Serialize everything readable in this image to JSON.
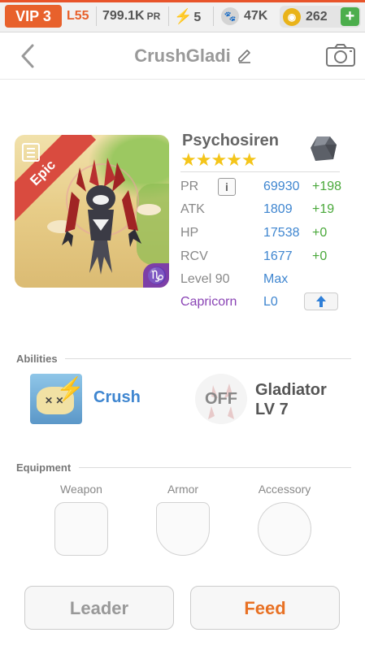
{
  "topbar": {
    "vip": "VIP 3",
    "level": "L55",
    "pr": "799.1K",
    "pr_unit": "PR",
    "energy": "5",
    "paws": "47K",
    "coins": "262",
    "plus": "+"
  },
  "header": {
    "title": "CrushGladi"
  },
  "monster": {
    "name": "Psychosiren",
    "rarity": "Epic",
    "zodiac_glyph": "♑",
    "stars": "★★★★★",
    "stats": [
      {
        "label": "PR",
        "value": "69930",
        "bonus": "+198"
      },
      {
        "label": "ATK",
        "value": "1809",
        "bonus": "+19"
      },
      {
        "label": "HP",
        "value": "17538",
        "bonus": "+0"
      },
      {
        "label": "RCV",
        "value": "1677",
        "bonus": "+0"
      }
    ],
    "level_label": "Level 90",
    "level_value": "Max",
    "zodiac_label": "Capricorn",
    "zodiac_level": "L0",
    "info_glyph": "i"
  },
  "abilities": {
    "title": "Abilities",
    "active_name": "Crush",
    "passive_state": "OFF",
    "passive_name": "Gladiator",
    "passive_level": "LV 7"
  },
  "equipment": {
    "title": "Equipment",
    "slots": [
      "Weapon",
      "Armor",
      "Accessory"
    ]
  },
  "buttons": {
    "leader": "Leader",
    "feed": "Feed"
  },
  "colors": {
    "accent": "#e8612c",
    "link": "#3f86d0",
    "bonus": "#49a83a",
    "zodiac": "#8a44b5"
  }
}
